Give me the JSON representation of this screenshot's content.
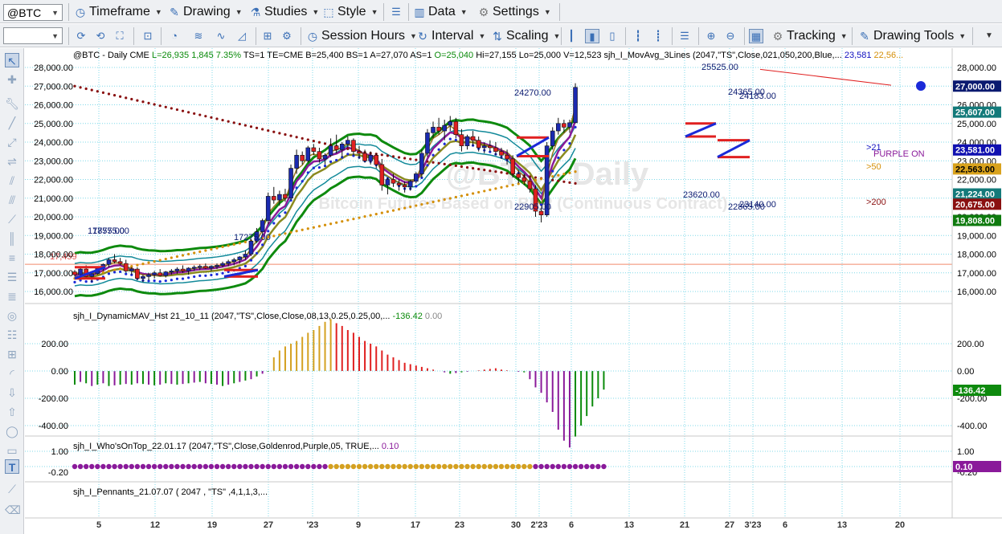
{
  "symbol_box": {
    "value": "@BTC"
  },
  "toolbar1": {
    "timeframe": "Timeframe",
    "drawing": "Drawing",
    "studies": "Studies",
    "style": "Style",
    "data": "Data",
    "settings": "Settings"
  },
  "toolbar2": {
    "session_hours": "Session Hours",
    "interval": "Interval",
    "scaling": "Scaling",
    "tracking": "Tracking",
    "drawing_tools": "Drawing Tools"
  },
  "header": [
    {
      "t": "@BTC - Daily  CME  ",
      "c": "#000"
    },
    {
      "t": "L=26,935  1,845  7.35%",
      "c": "#0a8a0a"
    },
    {
      "t": "  TS=1  TE=CME  B=25,400  BS=1  A=27,070  AS=1  ",
      "c": "#000"
    },
    {
      "t": "O=25,040",
      "c": "#0a8a0a"
    },
    {
      "t": "  Hi=27,155  Lo=25,000  V=12,523  sjh_I_MovAvg_3Lines (2047,\"TS\",Close,021,050,200,Blue,...  ",
      "c": "#000"
    },
    {
      "t": "23,581",
      "c": "#1010c0"
    },
    {
      "t": "  22,56...",
      "c": "#d4900a"
    }
  ],
  "watermark": {
    "title": "@BTC - Daily",
    "subtitle": "Bitcoin Futures Based on BRR (Continuous Contract)"
  },
  "price_axis": {
    "labels": [
      "28,000.00",
      "27,000.00",
      "26,000.00",
      "25,000.00",
      "24,000.00",
      "23,000.00",
      "22,000.00",
      "21,000.00",
      "20,000.00",
      "19,000.00",
      "18,000.00",
      "17,000.00",
      "16,000.00"
    ],
    "tags": [
      {
        "text": "27,000.00",
        "bg": "#0a1a70",
        "fg": "#ffffff",
        "y": 27000
      },
      {
        "text": "25,607.00",
        "bg": "#137a7a",
        "fg": "#ffffff",
        "y": 25607
      },
      {
        "text": "23,581.00",
        "bg": "#1010b0",
        "fg": "#ffffff",
        "y": 23581
      },
      {
        "text": "22,563.00",
        "bg": "#d9a21c",
        "fg": "#000000",
        "y": 22563
      },
      {
        "text": "21,224.00",
        "bg": "#137a7a",
        "fg": "#ffffff",
        "y": 21224
      },
      {
        "text": "20,675.00",
        "bg": "#8a1010",
        "fg": "#ffffff",
        "y": 20675
      },
      {
        "text": "19,808.00",
        "bg": "#0e7a0e",
        "fg": "#ffffff",
        "y": 19808
      }
    ]
  },
  "price_annotations": [
    {
      "text": "25525.00",
      "x": 873,
      "y": 87,
      "c": "#0a1a70"
    },
    {
      "text": "24270.00",
      "x": 640,
      "y": 119,
      "c": "#0a1a70"
    },
    {
      "text": "24365.00",
      "x": 906,
      "y": 118,
      "c": "#0a1a70"
    },
    {
      "text": "24183.00",
      "x": 920,
      "y": 123,
      "c": "#0a1a70"
    },
    {
      "text": "17875.00",
      "x": 109,
      "y": 291,
      "c": "#0a1a70"
    },
    {
      "text": "17575.00",
      "x": 115,
      "y": 291,
      "c": "#0a1a70"
    },
    {
      "text": "17275.00",
      "x": 291,
      "y": 299,
      "c": "#0a1a70"
    },
    {
      "text": "22905.00",
      "x": 640,
      "y": 261,
      "c": "#0a1a70"
    },
    {
      "text": "23620.00",
      "x": 850,
      "y": 246,
      "c": "#0a1a70"
    },
    {
      "text": "22865.00",
      "x": 906,
      "y": 261,
      "c": "#0a1a70"
    },
    {
      "text": "23140.00",
      "x": 920,
      "y": 258,
      "c": "#0a1a70"
    },
    {
      "text": "17,459",
      "x": 62,
      "y": 323,
      "c": "#e05050"
    },
    {
      "text": ">21",
      "x": 1078,
      "y": 187,
      "c": "#1010c0"
    },
    {
      "text": "PURPLE ON",
      "x": 1087,
      "y": 195,
      "c": "#8a1a9a"
    },
    {
      "text": ">50",
      "x": 1078,
      "y": 211,
      "c": "#d4900a"
    },
    {
      "text": ">200",
      "x": 1078,
      "y": 255,
      "c": "#8a1010"
    }
  ],
  "chart_data": [
    {
      "type": "candlestick",
      "title": "@BTC - Daily",
      "ylim": [
        15500,
        28400
      ],
      "series": [
        {
          "name": "sjh_I_MovAvg_3Lines",
          "values": []
        }
      ],
      "last": {
        "L": 26935,
        "chg": 1845,
        "pct": "7.35%",
        "O": 25040,
        "Hi": 27155,
        "Lo": 25000,
        "V": 12523,
        "ma21": 23581,
        "ma50": 22563,
        "ma200": 20675
      },
      "candles": [
        [
          17050,
          17150,
          16800,
          16900
        ],
        [
          16900,
          17300,
          16850,
          17200
        ],
        [
          17200,
          17400,
          16700,
          16800
        ],
        [
          16800,
          17000,
          16500,
          16950
        ],
        [
          16950,
          17300,
          16900,
          17250
        ],
        [
          17250,
          17500,
          17100,
          17450
        ],
        [
          17450,
          17800,
          17300,
          17700
        ],
        [
          17700,
          18000,
          17500,
          17600
        ],
        [
          17600,
          17800,
          17400,
          17500
        ],
        [
          17500,
          17700,
          17000,
          17100
        ],
        [
          17100,
          17300,
          16900,
          17200
        ],
        [
          17200,
          17300,
          16600,
          16700
        ],
        [
          16700,
          16900,
          16500,
          16800
        ],
        [
          16800,
          17000,
          16600,
          16900
        ],
        [
          16900,
          17100,
          16700,
          17000
        ],
        [
          17000,
          17200,
          16800,
          16850
        ],
        [
          16850,
          17100,
          16750,
          17050
        ],
        [
          17050,
          17200,
          16900,
          17100
        ],
        [
          17100,
          17300,
          16950,
          17200
        ],
        [
          17200,
          17400,
          17000,
          17100
        ],
        [
          17100,
          17300,
          16900,
          17250
        ],
        [
          17250,
          17400,
          17100,
          17300
        ],
        [
          17300,
          17450,
          17150,
          17350
        ],
        [
          17350,
          17500,
          17200,
          17250
        ],
        [
          17250,
          17400,
          17100,
          17350
        ],
        [
          17350,
          17500,
          17200,
          17400
        ],
        [
          17400,
          17600,
          17300,
          17500
        ],
        [
          17500,
          17700,
          17350,
          17600
        ],
        [
          17600,
          17800,
          17400,
          17700
        ],
        [
          17700,
          17900,
          17500,
          17850
        ],
        [
          17850,
          18200,
          17700,
          18000
        ],
        [
          18000,
          18800,
          17900,
          18700
        ],
        [
          18700,
          19400,
          18600,
          19200
        ],
        [
          19200,
          19900,
          19000,
          19800
        ],
        [
          19800,
          21300,
          19600,
          21100
        ],
        [
          21100,
          21600,
          20700,
          20900
        ],
        [
          20900,
          21400,
          20600,
          21200
        ],
        [
          21200,
          21500,
          20800,
          21000
        ],
        [
          21000,
          22800,
          20900,
          22600
        ],
        [
          22600,
          23600,
          22300,
          23300
        ],
        [
          23300,
          23500,
          22800,
          23000
        ],
        [
          23000,
          23800,
          22900,
          23700
        ],
        [
          23700,
          23900,
          23300,
          23500
        ],
        [
          23500,
          23700,
          22900,
          23100
        ],
        [
          23100,
          23400,
          22800,
          23300
        ],
        [
          23300,
          24200,
          23200,
          23800
        ],
        [
          23800,
          24400,
          23400,
          23600
        ],
        [
          23600,
          24000,
          23200,
          23900
        ],
        [
          23900,
          24300,
          23700,
          24100
        ],
        [
          24100,
          24200,
          23300,
          23500
        ],
        [
          23500,
          23800,
          23100,
          23400
        ],
        [
          23400,
          23600,
          22900,
          23000
        ],
        [
          23000,
          23500,
          22800,
          23300
        ],
        [
          23300,
          23400,
          22600,
          22800
        ],
        [
          22800,
          23100,
          21400,
          21700
        ],
        [
          21700,
          22100,
          21200,
          22000
        ],
        [
          22000,
          22300,
          21600,
          21800
        ],
        [
          21800,
          22000,
          21400,
          21700
        ],
        [
          21700,
          21900,
          21300,
          21600
        ],
        [
          21600,
          22000,
          21400,
          21900
        ],
        [
          21900,
          22400,
          21800,
          22300
        ],
        [
          22300,
          23600,
          22100,
          23400
        ],
        [
          23400,
          24700,
          23200,
          24500
        ],
        [
          24500,
          25100,
          24200,
          24800
        ],
        [
          24800,
          25300,
          24400,
          24600
        ],
        [
          24600,
          25200,
          24100,
          24900
        ],
        [
          24900,
          25400,
          24600,
          25100
        ],
        [
          25100,
          25300,
          24200,
          24400
        ],
        [
          24400,
          24700,
          23500,
          23800
        ],
        [
          23800,
          24400,
          23600,
          24300
        ],
        [
          24300,
          24600,
          23800,
          24100
        ],
        [
          24100,
          24300,
          23500,
          23700
        ],
        [
          23700,
          24000,
          23400,
          23800
        ],
        [
          23800,
          24100,
          23500,
          23700
        ],
        [
          23700,
          24000,
          23300,
          23500
        ],
        [
          23500,
          23700,
          23100,
          23300
        ],
        [
          23300,
          23600,
          22800,
          23100
        ],
        [
          23100,
          23300,
          22100,
          22300
        ],
        [
          22300,
          22500,
          21800,
          22100
        ],
        [
          22100,
          22300,
          21700,
          21900
        ],
        [
          21900,
          22100,
          21300,
          21500
        ],
        [
          21500,
          21700,
          20000,
          20300
        ],
        [
          20300,
          20500,
          19700,
          20100
        ],
        [
          20100,
          24000,
          20000,
          23800
        ],
        [
          23800,
          24800,
          23600,
          24600
        ],
        [
          24600,
          25300,
          24400,
          25000
        ],
        [
          25000,
          25200,
          24500,
          24800
        ],
        [
          24800,
          25200,
          24500,
          25040
        ],
        [
          25040,
          27155,
          25000,
          26935
        ]
      ]
    },
    {
      "type": "bar",
      "title": "sjh_I_DynamicMAV_Hst 21_10_11 (2047,\"TS\",Close,Close,08,13,0.25,0.25,00,...",
      "last_values": [
        "-136.42",
        "0.00"
      ],
      "ylim": [
        -620,
        420
      ],
      "values": [
        -100,
        -80,
        -90,
        -110,
        -100,
        -90,
        -110,
        -105,
        -100,
        -95,
        -100,
        -90,
        -95,
        -100,
        -105,
        -100,
        -90,
        -95,
        -100,
        -95,
        -90,
        -85,
        -80,
        -90,
        -95,
        -100,
        -110,
        -100,
        -90,
        -80,
        -70,
        -60,
        -40,
        -20,
        -5,
        100,
        150,
        180,
        200,
        220,
        250,
        280,
        300,
        330,
        360,
        380,
        350,
        330,
        300,
        280,
        250,
        220,
        200,
        180,
        150,
        120,
        100,
        80,
        60,
        50,
        40,
        30,
        20,
        10,
        0,
        -10,
        -20,
        -15,
        -10,
        -5,
        0,
        5,
        10,
        15,
        20,
        10,
        5,
        0,
        -5,
        -10,
        -60,
        -120,
        -160,
        -230,
        -300,
        -430,
        -510,
        -560,
        -480,
        -400,
        -330,
        -260,
        -200,
        -136.42
      ],
      "colors": [
        "#0a8a0a",
        "#8a1a9a",
        "#0a8a0a",
        "#8a1a9a",
        "#0a8a0a",
        "#8a1a9a",
        "#0a8a0a",
        "#8a1a9a",
        "#0a8a0a",
        "#8a1a9a",
        "#0a8a0a",
        "#8a1a9a",
        "#0a8a0a",
        "#8a1a9a",
        "#0a8a0a",
        "#8a1a9a",
        "#0a8a0a",
        "#8a1a9a",
        "#0a8a0a",
        "#8a1a9a",
        "#0a8a0a",
        "#8a1a9a",
        "#0a8a0a",
        "#8a1a9a",
        "#0a8a0a",
        "#8a1a9a",
        "#0a8a0a",
        "#8a1a9a",
        "#0a8a0a",
        "#8a1a9a",
        "#0a8a0a",
        "#8a1a9a",
        "#0a8a0a",
        "#8a1a9a",
        "#0a8a0a",
        "#d4a020",
        "#d4a020",
        "#d4a020",
        "#d4a020",
        "#d4a020",
        "#d4a020",
        "#d4a020",
        "#d4a020",
        "#d4a020",
        "#d4a020",
        "#d4a020",
        "#e02020",
        "#e02020",
        "#e02020",
        "#e02020",
        "#e02020",
        "#e02020",
        "#e02020",
        "#e02020",
        "#e02020",
        "#e02020",
        "#e02020",
        "#e02020",
        "#e02020",
        "#e02020",
        "#e02020",
        "#e02020",
        "#e02020",
        "#e02020",
        "#e02020",
        "#8a1a9a",
        "#0a8a0a",
        "#8a1a9a",
        "#0a8a0a",
        "#8a1a9a",
        "#e02020",
        "#e02020",
        "#e02020",
        "#e02020",
        "#e02020",
        "#e02020",
        "#e02020",
        "#e02020",
        "#8a1a9a",
        "#0a8a0a",
        "#8a1a9a",
        "#8a1a9a",
        "#8a1a9a",
        "#8a1a9a",
        "#8a1a9a",
        "#8a1a9a",
        "#8a1a9a",
        "#8a1a9a",
        "#0a8a0a",
        "#0a8a0a",
        "#0a8a0a",
        "#0a8a0a",
        "#0a8a0a",
        "#0a8a0a"
      ],
      "axis_labels": [
        "200.00",
        "0.00",
        "-200.00",
        "-400.00"
      ],
      "tag": "-136.42"
    },
    {
      "type": "scatter",
      "title": "sjh_I_Who'sOnTop_22.01.17 (2047,\"TS\",Close,Goldenrod,Purple,05, TRUE,...",
      "last_values": [
        "0.10"
      ],
      "axis_labels": [
        "1.00",
        "-0.20"
      ],
      "tag": "0.10",
      "segments": [
        {
          "from": 0,
          "to": 44,
          "color": "#8a1a9a"
        },
        {
          "from": 45,
          "to": 80,
          "color": "#d4a020"
        },
        {
          "from": 81,
          "to": 93,
          "color": "#8a1a9a"
        }
      ]
    },
    {
      "type": "other",
      "title": "sjh_I_Pennants_21.07.07 ( 2047 , \"TS\" ,4,1,1,3,..."
    }
  ],
  "x_axis": {
    "labels": [
      "5",
      "12",
      "19",
      "27",
      "'23",
      "9",
      "17",
      "23",
      "30",
      "2'23",
      "6",
      "13",
      "21",
      "27",
      "3'23",
      "6",
      "13",
      "20"
    ],
    "x": [
      123,
      193,
      264,
      334,
      389,
      446,
      517,
      572,
      642,
      671,
      711,
      783,
      852,
      908,
      937,
      977,
      1048,
      1120
    ]
  }
}
